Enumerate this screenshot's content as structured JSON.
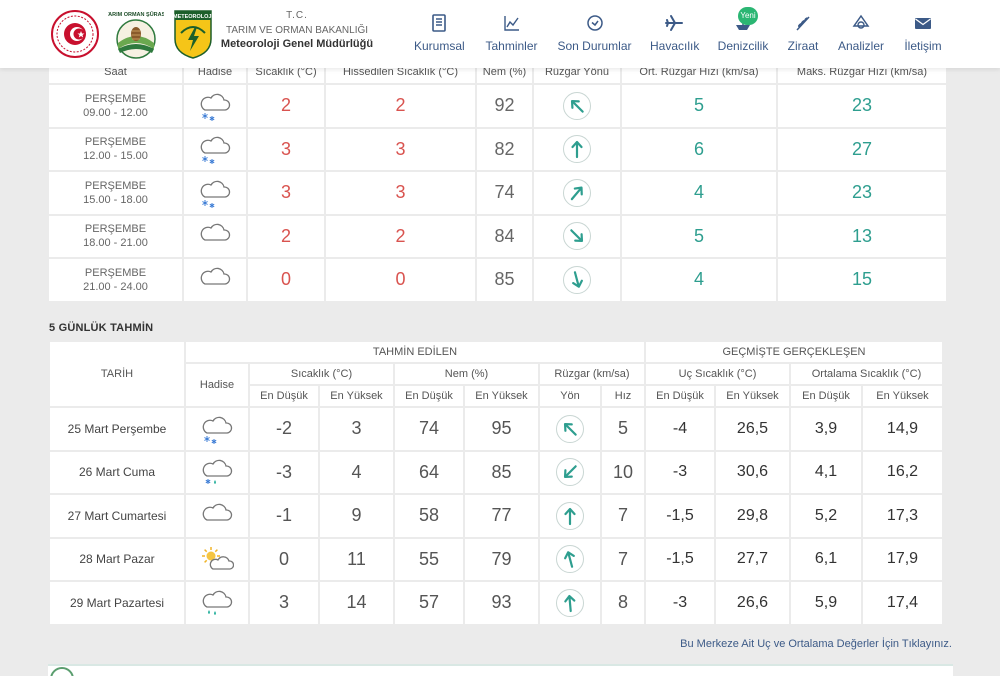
{
  "header": {
    "tc": "T.C.",
    "ministry": "TARIM VE ORMAN BAKANLIĞI",
    "mgm": "Meteoroloji Genel Müdürlüğü",
    "logos": [
      "tarim-orman-logo",
      "tarim-orman-surasi-logo",
      "meteoroloji-logo"
    ],
    "logo_texts": {
      "surasi": "TARIM ORMAN ŞÛRASI",
      "meteoroloji": "METEOROLOJİ"
    },
    "nav": [
      {
        "label": "Kurumsal",
        "icon": "building-icon"
      },
      {
        "label": "Tahminler",
        "icon": "chart-icon"
      },
      {
        "label": "Son Durumlar",
        "icon": "clock-check-icon"
      },
      {
        "label": "Havacılık",
        "icon": "plane-icon"
      },
      {
        "label": "Denizcilik",
        "icon": "ship-icon",
        "badge": "Yeni"
      },
      {
        "label": "Ziraat",
        "icon": "wheat-icon"
      },
      {
        "label": "Analizler",
        "icon": "analysis-icon"
      },
      {
        "label": "İletişim",
        "icon": "envelope-icon"
      }
    ]
  },
  "hourly": {
    "headers": [
      "Saat",
      "Hadise",
      "Sıcaklık (°C)",
      "Hissedilen Sıcaklık (°C)",
      "Nem (%)",
      "Rüzgar Yönü",
      "Ort. Rüzgar Hızı (km/sa)",
      "Maks. Rüzgar Hızı (km/sa)"
    ],
    "rows": [
      {
        "day": "PERŞEMBE",
        "time": "09.00 - 12.00",
        "icon": "snow-cloud-icon",
        "temp": "2",
        "feels": "2",
        "humidity": "92",
        "wind_dir_deg": 135,
        "avg_wind": "5",
        "max_wind": "23"
      },
      {
        "day": "PERŞEMBE",
        "time": "12.00 - 15.00",
        "icon": "snow-cloud-icon",
        "temp": "3",
        "feels": "3",
        "humidity": "82",
        "wind_dir_deg": 180,
        "avg_wind": "6",
        "max_wind": "27"
      },
      {
        "day": "PERŞEMBE",
        "time": "15.00 - 18.00",
        "icon": "snow-cloud-icon",
        "temp": "3",
        "feels": "3",
        "humidity": "74",
        "wind_dir_deg": 220,
        "avg_wind": "4",
        "max_wind": "23"
      },
      {
        "day": "PERŞEMBE",
        "time": "18.00 - 21.00",
        "icon": "cloud-icon",
        "temp": "2",
        "feels": "2",
        "humidity": "84",
        "wind_dir_deg": 315,
        "avg_wind": "5",
        "max_wind": "13"
      },
      {
        "day": "PERŞEMBE",
        "time": "21.00 - 24.00",
        "icon": "cloud-icon",
        "temp": "0",
        "feels": "0",
        "humidity": "85",
        "wind_dir_deg": 345,
        "avg_wind": "4",
        "max_wind": "15"
      }
    ]
  },
  "five_day": {
    "title": "5 GÜNLÜK TAHMİN",
    "group_forecast": "TAHMİN EDİLEN",
    "group_actual": "GEÇMİŞTE GERÇEKLEŞEN",
    "col_date": "TARİH",
    "col_event": "Hadise",
    "col_temp": "Sıcaklık (°C)",
    "col_humidity": "Nem (%)",
    "col_wind": "Rüzgar (km/sa)",
    "col_extreme": "Uç Sıcaklık (°C)",
    "col_average": "Ortalama Sıcaklık (°C)",
    "low": "En Düşük",
    "high": "En Yüksek",
    "dir": "Yön",
    "speed": "Hız",
    "rows": [
      {
        "date": "25 Mart Perşembe",
        "icon": "snow-cloud-icon",
        "tmin": "-2",
        "tmax": "3",
        "hmin": "74",
        "hmax": "95",
        "wind_dir_deg": 135,
        "wind": "5",
        "ext_min": "-4",
        "ext_max": "26,5",
        "avg_min": "3,9",
        "avg_max": "14,9"
      },
      {
        "date": "26 Mart Cuma",
        "icon": "sleet-cloud-icon",
        "tmin": "-3",
        "tmax": "4",
        "hmin": "64",
        "hmax": "85",
        "wind_dir_deg": 45,
        "wind": "10",
        "ext_min": "-3",
        "ext_max": "30,6",
        "avg_min": "4,1",
        "avg_max": "16,2"
      },
      {
        "date": "27 Mart Cumartesi",
        "icon": "cloud-icon",
        "tmin": "-1",
        "tmax": "9",
        "hmin": "58",
        "hmax": "77",
        "wind_dir_deg": 180,
        "wind": "7",
        "ext_min": "-1,5",
        "ext_max": "29,8",
        "avg_min": "5,2",
        "avg_max": "17,3"
      },
      {
        "date": "28 Mart Pazar",
        "icon": "sun-cloud-icon",
        "tmin": "0",
        "tmax": "11",
        "hmin": "55",
        "hmax": "79",
        "wind_dir_deg": 165,
        "wind": "7",
        "ext_min": "-1,5",
        "ext_max": "27,7",
        "avg_min": "6,1",
        "avg_max": "17,9"
      },
      {
        "date": "29 Mart Pazartesi",
        "icon": "rain-cloud-icon",
        "tmin": "3",
        "tmax": "14",
        "hmin": "57",
        "hmax": "93",
        "wind_dir_deg": 175,
        "wind": "8",
        "ext_min": "-3",
        "ext_max": "26,6",
        "avg_min": "5,9",
        "avg_max": "17,4"
      }
    ]
  },
  "footer_link": "Bu Merkeze Ait Uç ve Ortalama Değerler İçin Tıklayınız.",
  "colors": {
    "accent": "#3c5a87",
    "teal": "#2e9e8f",
    "red": "#d9534f",
    "orange": "#e09f3e",
    "badge": "#2bb673"
  }
}
